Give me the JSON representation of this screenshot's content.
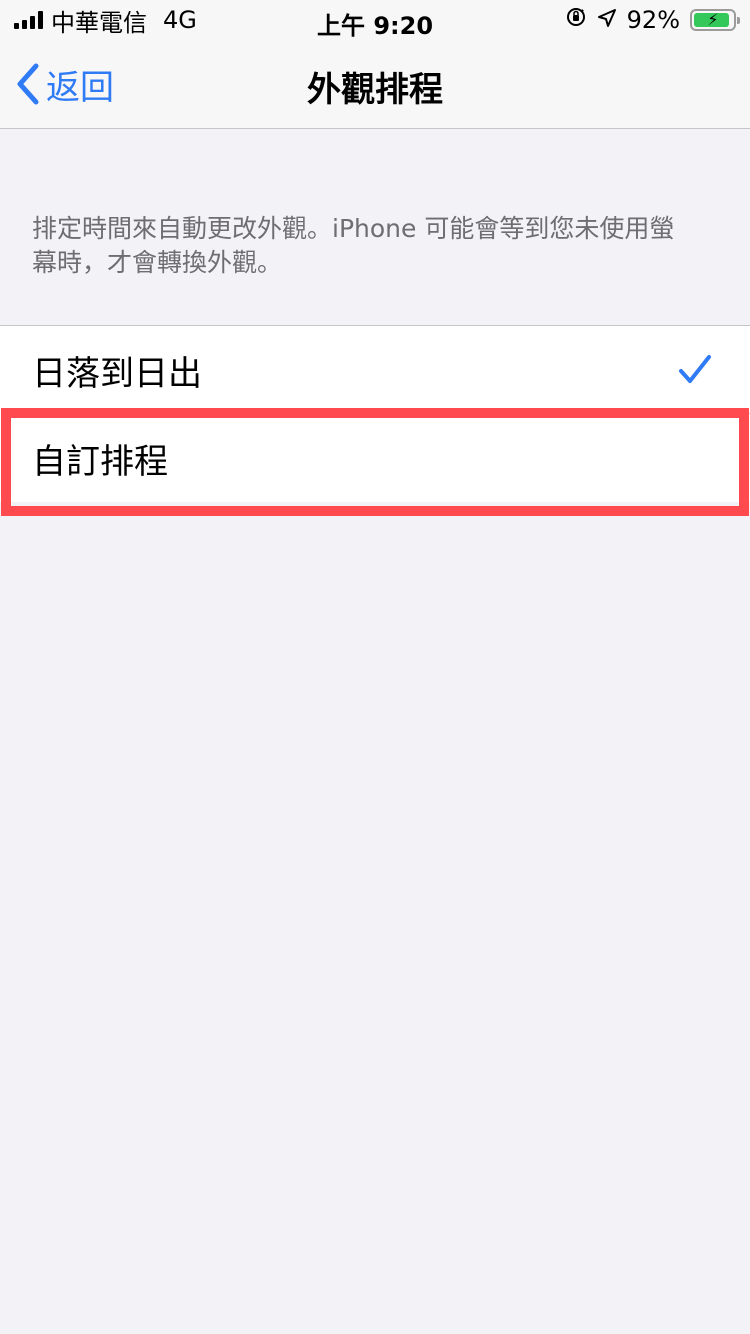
{
  "status_bar": {
    "carrier": "中華電信",
    "network": "4G",
    "time": "上午 9:20",
    "battery_percent": "92%",
    "battery_level": 0.92,
    "icons": [
      "signal-icon",
      "orientation-lock-icon",
      "location-arrow-icon",
      "battery-charging-icon"
    ]
  },
  "nav": {
    "back_label": "返回",
    "title": "外觀排程"
  },
  "description": "排定時間來自動更改外觀。iPhone 可能會等到您未使用螢\n幕時，才會轉換外觀。",
  "options": [
    {
      "label": "日落到日出",
      "selected": true
    },
    {
      "label": "自訂排程",
      "selected": false
    }
  ],
  "colors": {
    "accent": "#2F7BF5",
    "highlight_border": "#FF4A4F",
    "background": "#F2F2F7"
  }
}
